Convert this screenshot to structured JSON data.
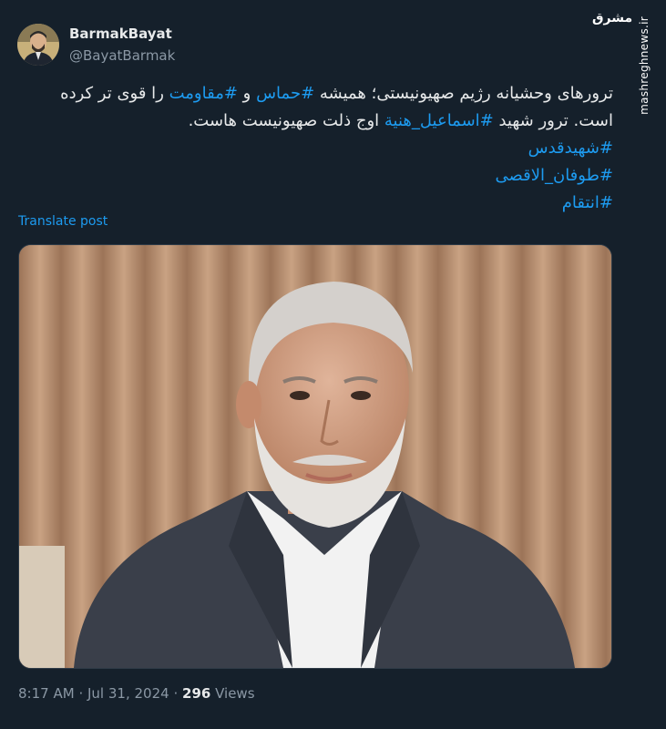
{
  "author": {
    "display_name": "BarmakBayat",
    "handle": "@BayatBarmak"
  },
  "tweet": {
    "line1_a": "ترورهای وحشیانه رژیم صهیونیستی؛ همیشه ",
    "hashtag_hamas": "#حماس",
    "line1_b": " و ",
    "hashtag_resistance": "#مقاومت",
    "line1_c": " را قوی تر کرده",
    "line2_a": "است. ترور شهید ",
    "hashtag_haniyeh": "#اسماعیل_هنیة",
    "line2_b": " اوج ذلت صهیونیست هاست.",
    "hashtags": [
      "#شهیدقدس",
      "#طوفان_الاقصی",
      "#انتقام"
    ]
  },
  "translate_label": "Translate post",
  "meta": {
    "time": "8:17 AM",
    "separator": "·",
    "date": "Jul 31, 2024",
    "views_count": "296",
    "views_label": "Views"
  },
  "watermark": {
    "site": "mashreghnews.ir",
    "logo": "مشرق"
  },
  "colors": {
    "background": "#15202b",
    "link": "#1d9bf0",
    "secondary_text": "#8b98a5",
    "primary_text": "#e7e9ea"
  }
}
